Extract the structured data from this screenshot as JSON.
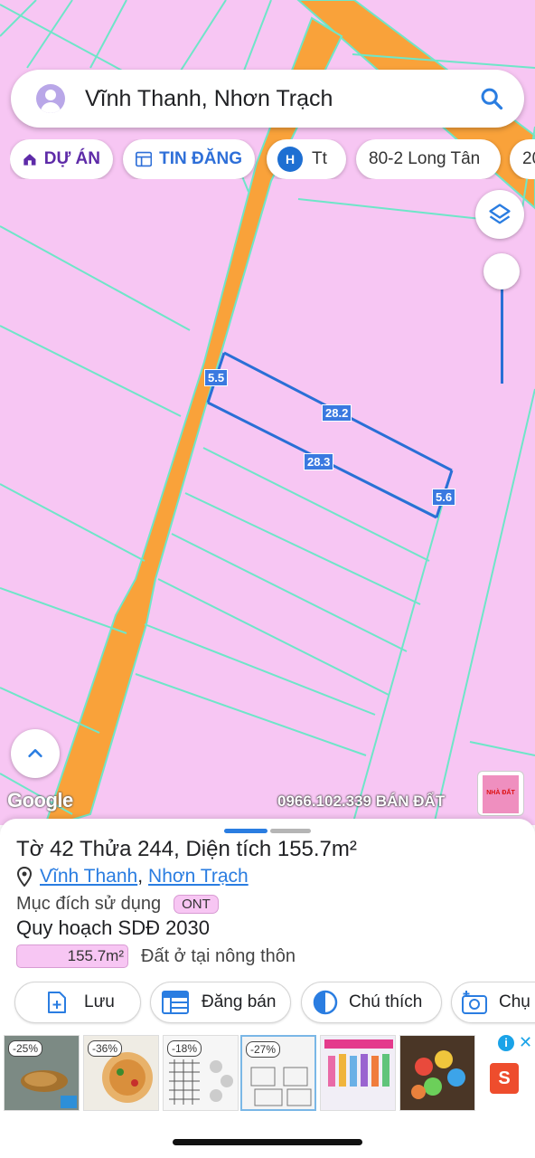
{
  "search": {
    "value": "Vĩnh Thanh, Nhơn Trạch"
  },
  "chips": [
    {
      "label": "DỰ ÁN",
      "icon": "house-icon"
    },
    {
      "label": "TIN ĐĂNG",
      "icon": "listing-icon"
    },
    {
      "label": "Tt",
      "icon": "H"
    },
    {
      "label": "80-2 Long Tân"
    },
    {
      "label": "20"
    }
  ],
  "map": {
    "dimensions": [
      "5.5",
      "28.2",
      "28.3",
      "5.6"
    ],
    "google_logo": "Google",
    "watermark": "0966.102.339 BÁN ĐẤT",
    "mini_logo_text": "NHÀ ĐẤT"
  },
  "parcel": {
    "title": "Tờ 42 Thửa 244, Diện tích 155.7m²",
    "ward": "Vĩnh Thanh",
    "district": "Nhơn Trạch",
    "separator": ",",
    "purpose_label": "Mục đích sử dụng",
    "purpose_code": "ONT",
    "plan_title": "Quy hoạch SDĐ 2030",
    "plan_area": "155.7m²",
    "plan_desc": "Đất ở tại nông thôn"
  },
  "actions": {
    "save": "Lưu",
    "post_sale": "Đăng bán",
    "legend": "Chú thích",
    "capture": "Chụ"
  },
  "ads": {
    "discounts": [
      "-25%",
      "-36%",
      "-18%",
      "-27%"
    ],
    "info": "i",
    "close": "✕",
    "shop_letter": "S"
  },
  "colors": {
    "land_pink": "#f7c6f3",
    "road_orange": "#f9a23a",
    "boundary_cyan": "#6ee6c8",
    "accent_blue": "#2a7de1",
    "dim_blue": "#3a79e0"
  }
}
